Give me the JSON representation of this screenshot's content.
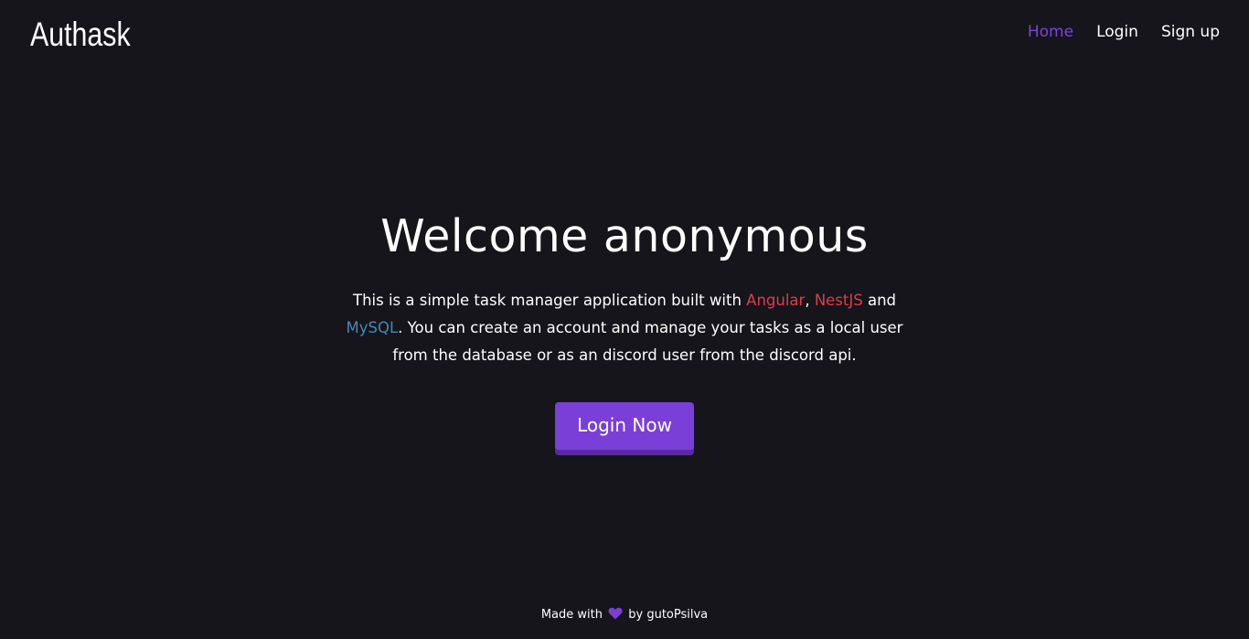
{
  "header": {
    "logo": "Authask",
    "nav": [
      {
        "label": "Home",
        "active": true
      },
      {
        "label": "Login",
        "active": false
      },
      {
        "label": "Sign up",
        "active": false
      }
    ]
  },
  "hero": {
    "title": "Welcome anonymous",
    "desc_intro": "This is a simple task manager application built with ",
    "tech_1": "Angular",
    "sep_1": ", ",
    "tech_2": "NestJS",
    "sep_2": " and ",
    "tech_3": "MySQL",
    "desc_rest": ". You can create an account and manage your tasks as a local user from the database or as an discord user from the discord api.",
    "button_label": "Login Now"
  },
  "footer": {
    "prefix": "Made with",
    "suffix": "by gutoPsilva",
    "icon": "heart-icon"
  },
  "colors": {
    "background": "#15151b",
    "accent": "#7a3fd6",
    "angular": "#e23b4a",
    "nestjs": "#e23b4a",
    "mysql": "#4a86b8"
  }
}
